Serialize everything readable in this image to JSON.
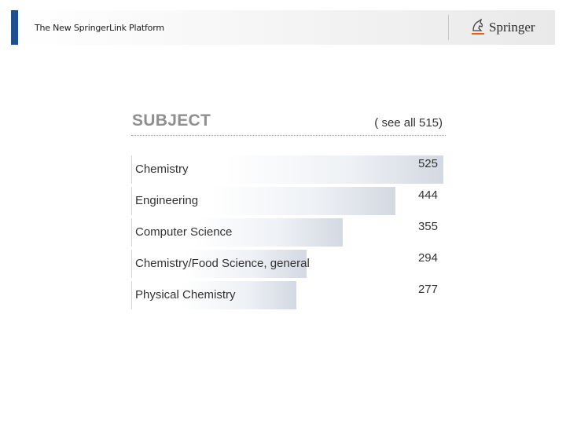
{
  "header": {
    "title": "The New SpringerLink Platform",
    "logo_text": "Springer",
    "logo_icon": "springer-horse-icon"
  },
  "subject": {
    "title": "SUBJECT",
    "see_all": "( see all 515)",
    "items": [
      {
        "label": "Chemistry",
        "count": "525",
        "share": 1.0
      },
      {
        "label": "Engineering",
        "count": "444",
        "share": 0.846
      },
      {
        "label": "Computer Science",
        "count": "355",
        "share": 0.676
      },
      {
        "label": "Chemistry/Food Science, general",
        "count": "294",
        "share": 0.56
      },
      {
        "label": "Physical Chemistry",
        "count": "277",
        "share": 0.528
      }
    ]
  }
}
